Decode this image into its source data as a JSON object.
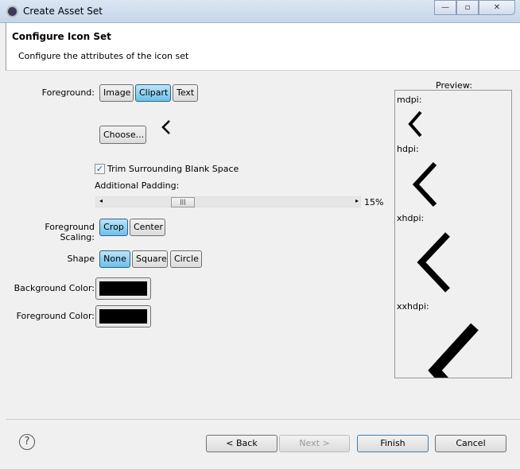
{
  "window": {
    "title": "Create Asset Set",
    "minimize": "—",
    "maximize": "▫",
    "close": "✕"
  },
  "header": {
    "title": "Configure Icon Set",
    "subtitle": "Configure the attributes of the icon set"
  },
  "foreground": {
    "label": "Foreground:",
    "options": [
      "Image",
      "Clipart",
      "Text"
    ],
    "selected": "Clipart"
  },
  "choose_label": "Choose...",
  "clipart_icon": "chevron-left-icon",
  "trim": {
    "label": "Trim Surrounding Blank Space",
    "checked": true
  },
  "padding": {
    "label": "Additional Padding:",
    "value_text": "15%",
    "value": 15
  },
  "scaling": {
    "label": "Foreground Scaling:",
    "options": [
      "Crop",
      "Center"
    ],
    "selected": "Crop"
  },
  "shape": {
    "label": "Shape",
    "options": [
      "None",
      "Square",
      "Circle"
    ],
    "selected": "None"
  },
  "background_color": {
    "label": "Background Color:",
    "value": "#000000"
  },
  "foreground_color": {
    "label": "Foreground Color:",
    "value": "#000000"
  },
  "preview": {
    "title": "Preview:",
    "densities": [
      "mdpi:",
      "hdpi:",
      "xhdpi:",
      "xxhdpi:"
    ]
  },
  "footer": {
    "back": "< Back",
    "next": "Next >",
    "finish": "Finish",
    "cancel": "Cancel",
    "help": "?"
  }
}
